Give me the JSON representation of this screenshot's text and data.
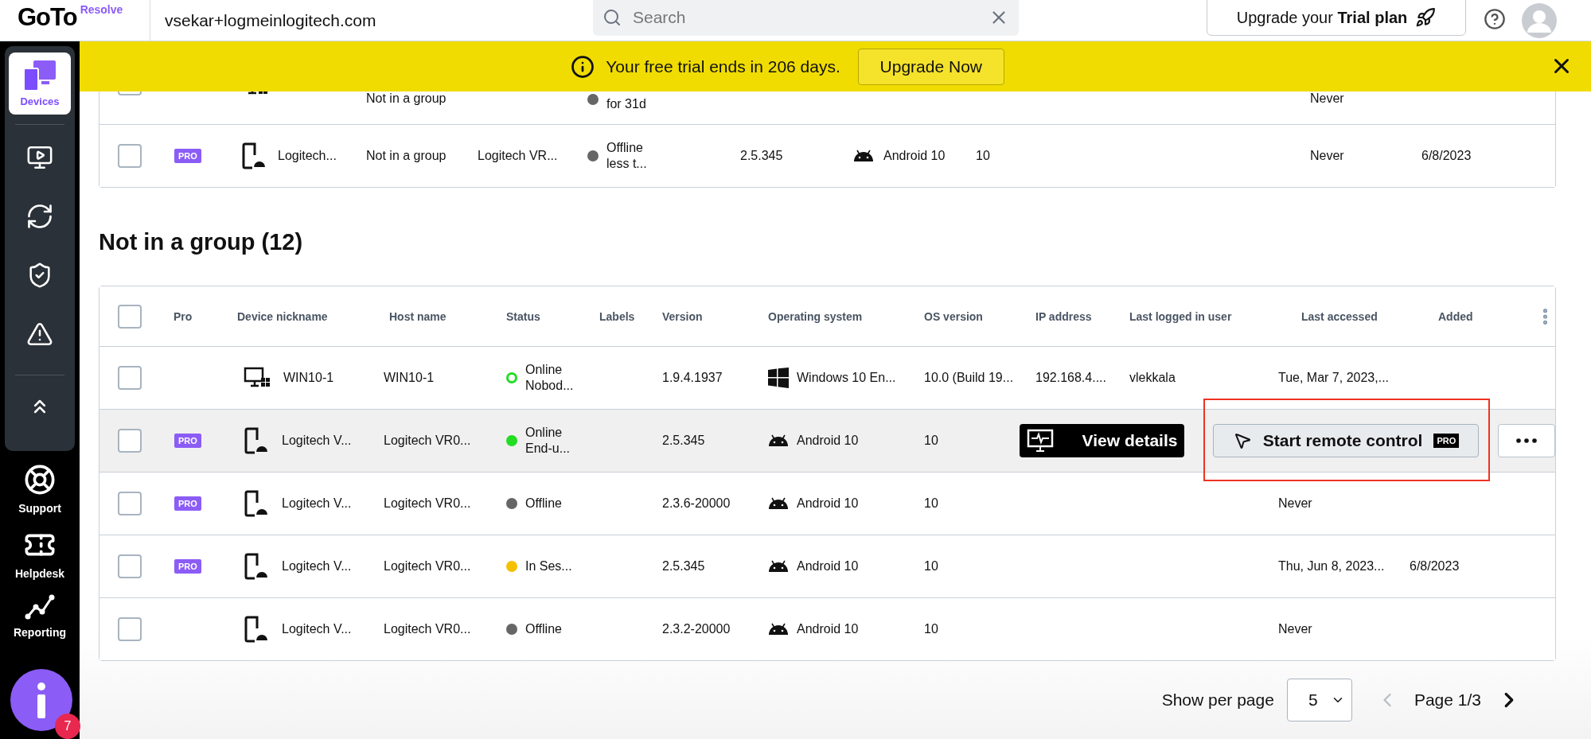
{
  "topbar": {
    "logo": "GoTo",
    "logo_sub": "Resolve",
    "account": "vsekar+logmeinlogitech.com",
    "search": {
      "placeholder": "Search"
    },
    "upgrade": "Upgrade your **Trial plan**"
  },
  "sidebar": {
    "items": [
      {
        "kind": "devices",
        "label": "Devices",
        "selected": true
      },
      {
        "kind": "remote",
        "selected": false
      },
      {
        "kind": "sync",
        "selected": false
      },
      {
        "kind": "shield",
        "selected": false
      },
      {
        "kind": "alert",
        "selected": false
      },
      {
        "kind": "collapse",
        "selected": false
      }
    ],
    "bottom": [
      {
        "kind": "support",
        "label": "Support"
      },
      {
        "kind": "helpdesk",
        "label": "Helpdesk"
      },
      {
        "kind": "reporting",
        "label": "Reporting"
      }
    ],
    "info_badge": "7"
  },
  "banner": {
    "text": "Your free trial ends in 206 days.",
    "button": "Upgrade Now"
  },
  "top_group": {
    "rows": [
      {
        "partial": true,
        "checked": false,
        "device": {
          "kind": "desktop"
        },
        "group": "Not in a group",
        "status": {
          "text": "for 31d",
          "color": "#666666",
          "kind": "filled"
        },
        "last_accessed": "Never"
      },
      {
        "partial": false,
        "checked": false,
        "pro": "PRO",
        "device": {
          "kind": "mobile",
          "nickname": "Logitech..."
        },
        "group": "Not in a group",
        "host": "Logitech VR...",
        "status": {
          "text": "Offline less t...",
          "color": "#666666",
          "kind": "filled"
        },
        "version": "2.5.345",
        "os": {
          "kind": "android",
          "name": "Android 10"
        },
        "os_version": "10",
        "last_accessed": "Never",
        "added": "6/8/2023"
      }
    ]
  },
  "group": {
    "title": "Not in a group (12)",
    "header_checked": false,
    "columns": [
      "Pro",
      "Device nickname",
      "Host name",
      "Status",
      "Labels",
      "Version",
      "Operating system",
      "OS version",
      "IP address",
      "Last logged in user",
      "Last accessed",
      "Added"
    ],
    "rows": [
      {
        "checked": false,
        "hovered": false,
        "device": {
          "kind": "desktop",
          "nickname": "WIN10-1"
        },
        "host": "WIN10-1",
        "status": {
          "text": "Online Nobod...",
          "color": "#22dd22",
          "kind": "ring"
        },
        "version": "1.9.4.1937",
        "os": {
          "kind": "windows",
          "name": "Windows 10 En..."
        },
        "os_version": "10.0 (Build 19...",
        "ip": "192.168.4....",
        "user": "vlekkala",
        "last_accessed": "Tue, Mar 7, 2023,..."
      },
      {
        "checked": false,
        "hovered": true,
        "pro": "PRO",
        "device": {
          "kind": "mobile",
          "nickname": "Logitech V..."
        },
        "host": "Logitech VR0...",
        "status": {
          "text": "Online End-u...",
          "color": "#22dd22",
          "kind": "filled"
        },
        "version": "2.5.345",
        "os": {
          "kind": "android",
          "name": "Android 10"
        },
        "os_version": "10",
        "actions": {
          "view": "View details",
          "remote": "Start remote control",
          "remote_badge": "PRO",
          "highlighted": true
        }
      },
      {
        "checked": false,
        "hovered": false,
        "pro": "PRO",
        "device": {
          "kind": "mobile",
          "nickname": "Logitech V..."
        },
        "host": "Logitech VR0...",
        "status": {
          "text": "Offline",
          "color": "#666666",
          "kind": "filled"
        },
        "version": "2.3.6-20000",
        "os": {
          "kind": "android",
          "name": "Android 10"
        },
        "os_version": "10",
        "last_accessed": "Never"
      },
      {
        "checked": false,
        "hovered": false,
        "pro": "PRO",
        "device": {
          "kind": "mobile",
          "nickname": "Logitech V..."
        },
        "host": "Logitech VR0...",
        "status": {
          "text": "In Ses...",
          "color": "#f5c000",
          "kind": "filled"
        },
        "version": "2.5.345",
        "os": {
          "kind": "android",
          "name": "Android 10"
        },
        "os_version": "10",
        "last_accessed": "Thu, Jun 8, 2023...",
        "added": "6/8/2023"
      },
      {
        "checked": false,
        "hovered": false,
        "device": {
          "kind": "mobile",
          "nickname": "Logitech V..."
        },
        "host": "Logitech VR0...",
        "status": {
          "text": "Offline",
          "color": "#666666",
          "kind": "filled"
        },
        "version": "2.3.2-20000",
        "os": {
          "kind": "android",
          "name": "Android 10"
        },
        "os_version": "10",
        "last_accessed": "Never"
      }
    ]
  },
  "pagination": {
    "label": "Show per page",
    "per_page": "5",
    "page": "Page 1/3",
    "prev": {
      "disabled": true
    },
    "next": {
      "disabled": false
    }
  }
}
